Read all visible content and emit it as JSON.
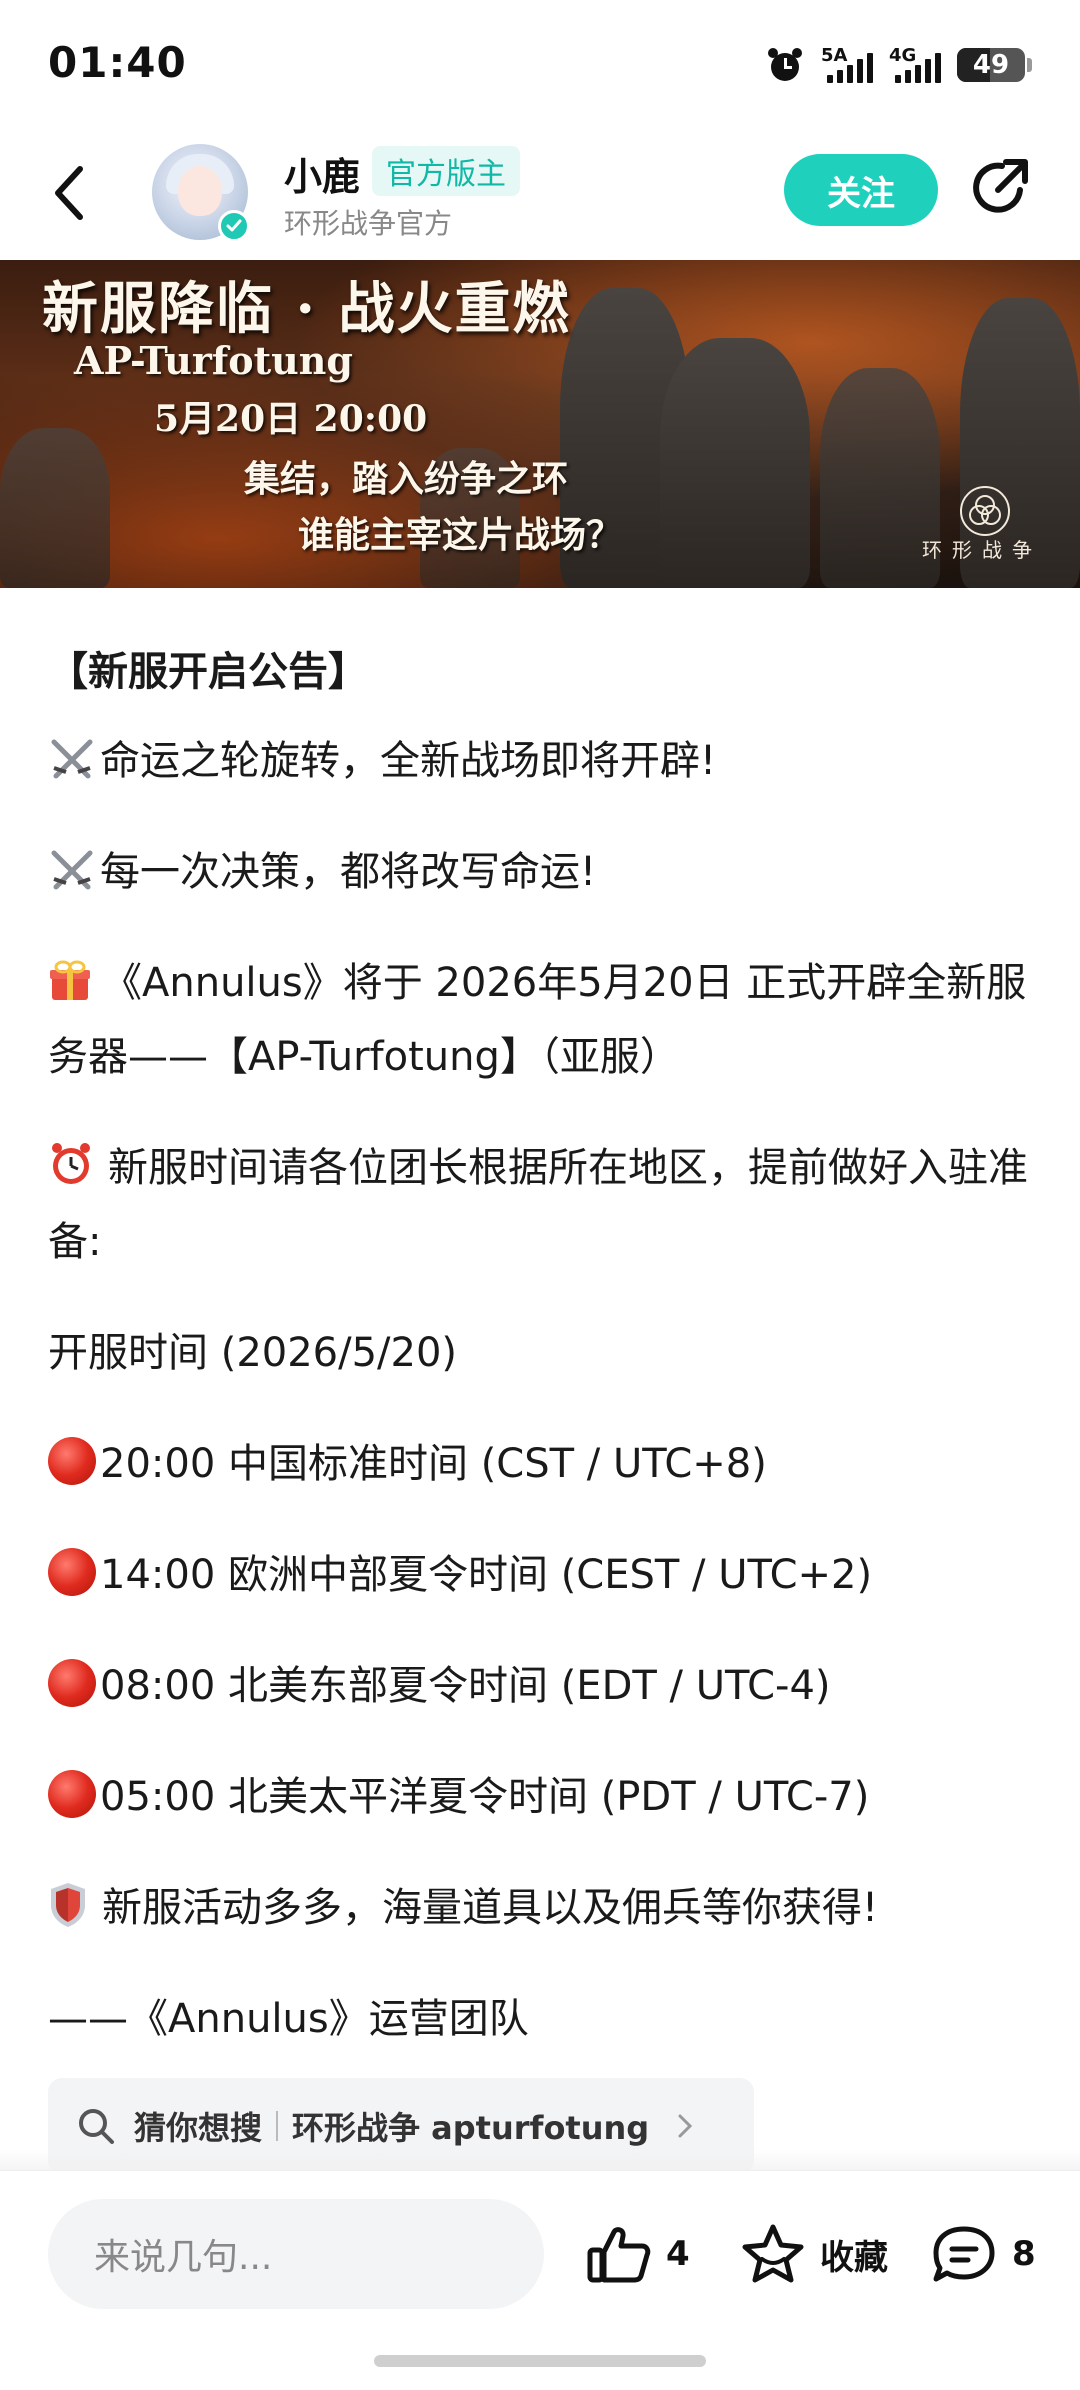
{
  "status_bar": {
    "time": "01:40",
    "network1": "5A",
    "network2": "4G",
    "battery": "49"
  },
  "header": {
    "author_name": "小鹿",
    "badge": "官方版主",
    "author_sub": "环形战争官方",
    "follow_label": "关注"
  },
  "banner": {
    "title": "新服降临 · 战火重燃",
    "server": "AP-Turfotung",
    "datetime": "5月20日 20:00",
    "line1": "集结，踏入纷争之环",
    "line2": "谁能主宰这片战场？",
    "logo_text": "环形战争"
  },
  "article": {
    "heading": "【新服开启公告】",
    "p1": "命运之轮旋转，全新战场即将开辟!",
    "p2": "每一次决策，都将改写命运!",
    "p3": "《Annulus》将于 2026年5月20日 正式开辟全新服务器——【AP-Turfotung】（亚服）",
    "p4": "新服时间请各位团长根据所在地区，提前做好入驻准备:",
    "p5": "开服时间 (2026/5/20)",
    "times": [
      "20:00  中国标准时间 (CST / UTC+8)",
      "14:00 欧洲中部夏令时间 (CEST / UTC+2)",
      "08:00 北美东部夏令时间 (EDT / UTC-4)",
      "05:00 北美太平洋夏令时间 (PDT / UTC-7)"
    ],
    "p6": "新服活动多多，海量道具以及佣兵等你获得!",
    "signature": "——《Annulus》运营团队"
  },
  "search_suggestion": {
    "label": "猜你想搜",
    "query": "环形战争 apturfotung"
  },
  "bottom_bar": {
    "comment_placeholder": "来说几句...",
    "like_count": "4",
    "favorite_label": "收藏",
    "comment_count": "8"
  },
  "colors": {
    "accent": "#1fd1bd",
    "badge_text": "#12b8a6",
    "badge_bg": "#e6f8f6"
  }
}
